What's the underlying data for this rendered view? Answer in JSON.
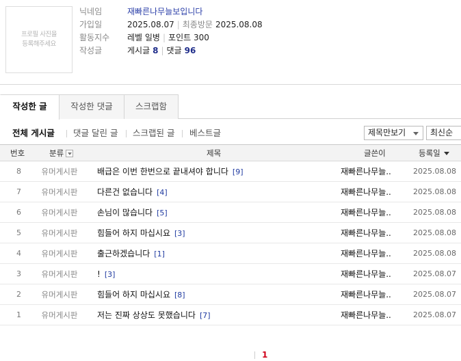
{
  "profile": {
    "photo_text_line1": "프로필 사진을",
    "photo_text_line2": "등록해주세요",
    "nickname_label": "닉네임",
    "nickname": "재빠른나무늘보입니다",
    "join_label": "가입일",
    "join_date": "2025.08.07",
    "last_visit_label": "최종방문",
    "last_visit_date": "2025.08.08",
    "activity_label": "활동지수",
    "level_text": "레벨 일병",
    "points_text": "포인트 300",
    "written_label": "작성글",
    "posts_label": "게시글",
    "posts_count": "8",
    "comments_label": "댓글",
    "comments_count": "96"
  },
  "tabs": [
    {
      "label": "작성한 글",
      "active": true
    },
    {
      "label": "작성한 댓글",
      "active": false
    },
    {
      "label": "스크랩함",
      "active": false
    }
  ],
  "filters": [
    {
      "label": "전체 게시글",
      "active": true
    },
    {
      "label": "댓글 달린 글",
      "active": false
    },
    {
      "label": "스크랩된 글",
      "active": false
    },
    {
      "label": "베스트글",
      "active": false
    }
  ],
  "view_select": "제목만보기",
  "sort_select": "최신순",
  "columns": {
    "num": "번호",
    "category": "분류",
    "title": "제목",
    "author": "글쓴이",
    "date": "등록일"
  },
  "posts": [
    {
      "num": "8",
      "category": "유머게시판",
      "title": "배급은 이번 한번으로 끝내셔야 합니다",
      "comments": "[9]",
      "author": "재빠른나무늘..",
      "date": "2025.08.08"
    },
    {
      "num": "7",
      "category": "유머게시판",
      "title": "다른건 없습니다",
      "comments": "[4]",
      "author": "재빠른나무늘..",
      "date": "2025.08.08"
    },
    {
      "num": "6",
      "category": "유머게시판",
      "title": "손님이 많습니다",
      "comments": "[5]",
      "author": "재빠른나무늘..",
      "date": "2025.08.08"
    },
    {
      "num": "5",
      "category": "유머게시판",
      "title": "힘들어 하지 마십시요",
      "comments": "[3]",
      "author": "재빠른나무늘..",
      "date": "2025.08.08"
    },
    {
      "num": "4",
      "category": "유머게시판",
      "title": "출근하겠습니다",
      "comments": "[1]",
      "author": "재빠른나무늘..",
      "date": "2025.08.08"
    },
    {
      "num": "3",
      "category": "유머게시판",
      "title": "!",
      "comments": "[3]",
      "author": "재빠른나무늘..",
      "date": "2025.08.07"
    },
    {
      "num": "2",
      "category": "유머게시판",
      "title": "힘들어 하지 마십시요",
      "comments": "[8]",
      "author": "재빠른나무늘..",
      "date": "2025.08.07"
    },
    {
      "num": "1",
      "category": "유머게시판",
      "title": "저는 진짜 상상도 못했습니다",
      "comments": "[7]",
      "author": "재빠른나무늘..",
      "date": "2025.08.07"
    }
  ],
  "pagination": {
    "current": "1"
  }
}
